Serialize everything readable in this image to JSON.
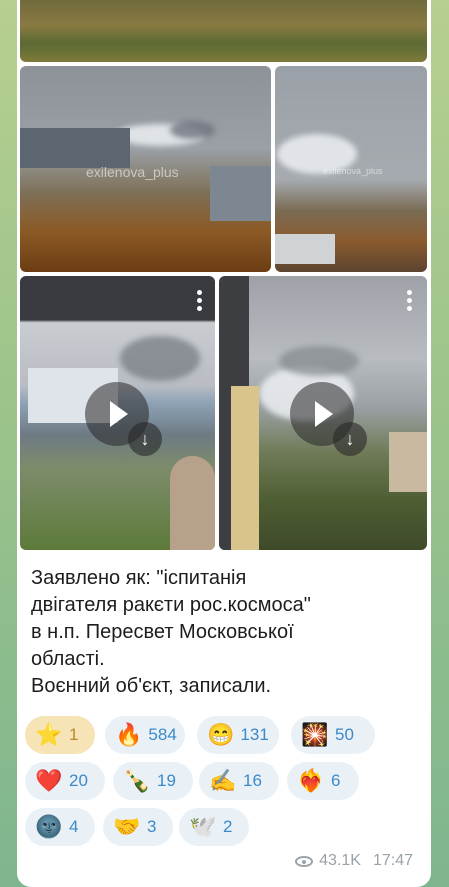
{
  "media": {
    "watermark": "exilenova_plus",
    "video_icons": {
      "play": "play-icon",
      "download": "download-arrow-icon",
      "menu": "more-vertical-icon"
    }
  },
  "message": {
    "text": "Заявлено як: \"іспитанія\nдвігателя ракєти рос.космоса\"\nв н.п. Пересвет Московської\nобласті.\nВоєнний об'єкт, записали."
  },
  "reactions": [
    {
      "emoji": "⭐",
      "count": "1",
      "active": true
    },
    {
      "emoji": "🔥",
      "count": "584"
    },
    {
      "emoji": "😁",
      "count": "131"
    },
    {
      "emoji": "🎇",
      "count": "50"
    },
    {
      "emoji": "❤️",
      "count": "20"
    },
    {
      "emoji": "🍾",
      "count": "19"
    },
    {
      "emoji": "✍️",
      "count": "16"
    },
    {
      "emoji": "❤️‍🔥",
      "count": "6"
    },
    {
      "emoji": "🌚",
      "count": "4"
    },
    {
      "emoji": "🤝",
      "count": "3"
    },
    {
      "emoji": "🕊️",
      "count": "2"
    }
  ],
  "meta": {
    "views": "43.1K",
    "time": "17:47"
  }
}
